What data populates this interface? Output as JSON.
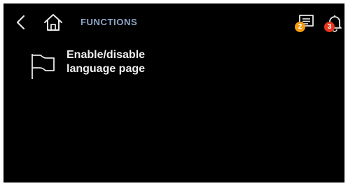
{
  "header": {
    "title": "FUNCTIONS",
    "back_icon": "chevron-left-icon",
    "home_icon": "home-icon",
    "messages": {
      "icon": "message-icon",
      "count": "2",
      "badge_color": "#f39c12"
    },
    "alarms": {
      "icon": "bell-icon",
      "count": "3",
      "badge_color": "#e8361e"
    },
    "title_color": "#8fa8c8"
  },
  "functions": {
    "items": [
      {
        "icon": "flag-icon",
        "label": "Enable/disable\nlanguage page"
      }
    ]
  }
}
